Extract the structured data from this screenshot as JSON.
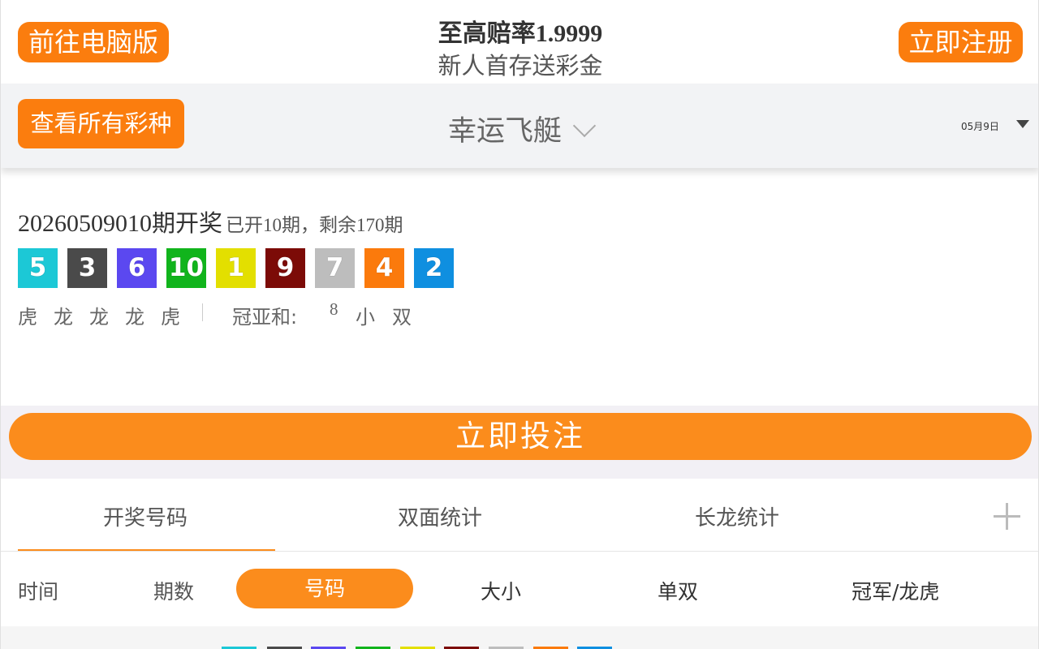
{
  "header": {
    "pc_button": "前往电脑版",
    "register_button": "立即注册",
    "promo_title_cn": "至高赔率",
    "promo_title_num": "1.9999",
    "promo_subtitle": "新人首存送彩金"
  },
  "selector": {
    "all_lotteries_button": "查看所有彩种",
    "lottery_name": "幸运飞艇",
    "date": "05月9日"
  },
  "result": {
    "issue_number": "20260509010",
    "issue_suffix": "期开奖",
    "progress_text": "已开10期，剩余170期",
    "balls": [
      {
        "value": "5",
        "color": "#1cc8d6"
      },
      {
        "value": "3",
        "color": "#4a4a4a"
      },
      {
        "value": "6",
        "color": "#5b48f0"
      },
      {
        "value": "10",
        "color": "#11b41c"
      },
      {
        "value": "1",
        "color": "#e3df00"
      },
      {
        "value": "9",
        "color": "#7c0b07"
      },
      {
        "value": "7",
        "color": "#bdbdbd"
      },
      {
        "value": "4",
        "color": "#fb7a0c"
      },
      {
        "value": "2",
        "color": "#0f8fe0"
      }
    ],
    "dragon_tiger": [
      "虎",
      "龙",
      "龙",
      "龙",
      "虎"
    ],
    "sum_label": "冠亚和:",
    "sum_value": "8",
    "sum_size": "小",
    "sum_parity": "双"
  },
  "bet_button": "立即投注",
  "tabs": [
    "开奖号码",
    "双面统计",
    "长龙统计"
  ],
  "filters": {
    "time": "时间",
    "issue": "期数",
    "number": "号码",
    "size": "大小",
    "parity": "单双",
    "champion": "冠军/龙虎"
  },
  "colors": {
    "accent": "#fb8c1c",
    "button_orange": "#fb7d0e"
  }
}
